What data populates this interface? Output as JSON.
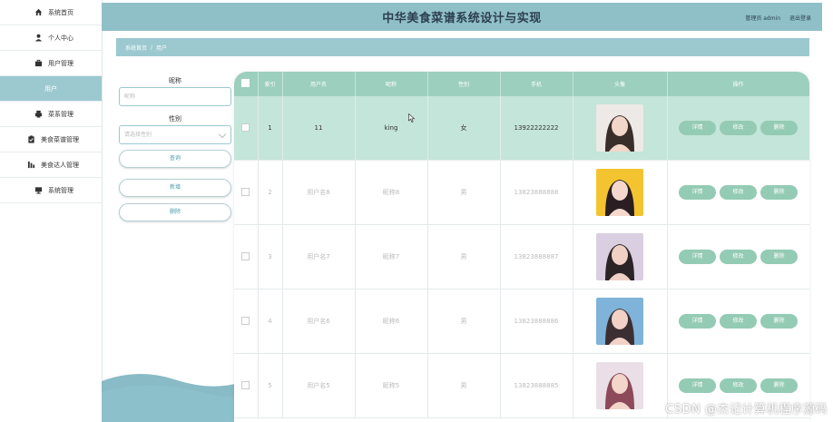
{
  "header": {
    "title": "中华美食菜谱系统设计与实现",
    "user_label": "管理员 admin",
    "logout_label": "退出登录"
  },
  "sidebar": {
    "items": [
      {
        "label": "系统首页",
        "icon": "home-icon"
      },
      {
        "label": "个人中心",
        "icon": "user-icon"
      },
      {
        "label": "用户管理",
        "icon": "briefcase-icon"
      },
      {
        "label": "用户",
        "icon": ""
      },
      {
        "label": "菜系管理",
        "icon": "print-icon"
      },
      {
        "label": "美食菜谱管理",
        "icon": "clipboard-icon"
      },
      {
        "label": "美食达人管理",
        "icon": "chart-icon"
      },
      {
        "label": "系统管理",
        "icon": "monitor-icon"
      }
    ]
  },
  "breadcrumb": {
    "home": "系统首页",
    "separator": "/",
    "current": "用户"
  },
  "search": {
    "nickname_label": "昵称",
    "nickname_placeholder": "昵称",
    "gender_label": "性别",
    "gender_placeholder": "请选择性别",
    "query_button": "查询",
    "add_button": "新增",
    "delete_button": "删除"
  },
  "table": {
    "headers": [
      "",
      "索引",
      "用户名",
      "昵称",
      "性别",
      "手机",
      "头像",
      "操作"
    ],
    "action_labels": {
      "detail": "详情",
      "edit": "修改",
      "delete": "删除"
    },
    "rows": [
      {
        "index": "1",
        "username": "11",
        "nickname": "king",
        "gender": "女",
        "phone": "13922222222"
      },
      {
        "index": "2",
        "username": "用户名8",
        "nickname": "昵称8",
        "gender": "男",
        "phone": "13823888888"
      },
      {
        "index": "3",
        "username": "用户名7",
        "nickname": "昵称7",
        "gender": "男",
        "phone": "13823888887"
      },
      {
        "index": "4",
        "username": "用户名6",
        "nickname": "昵称6",
        "gender": "男",
        "phone": "13823888886"
      },
      {
        "index": "5",
        "username": "用户名5",
        "nickname": "昵称5",
        "gender": "男",
        "phone": "13823888885"
      }
    ]
  },
  "colors": {
    "header": "#8fc0c8",
    "accent": "#9cc9d0",
    "table_header": "#9ccfbe",
    "row_selected": "#c4e5d9",
    "button": "#94cbb4"
  },
  "watermark": "CSDN @杰记计算机程序源码"
}
